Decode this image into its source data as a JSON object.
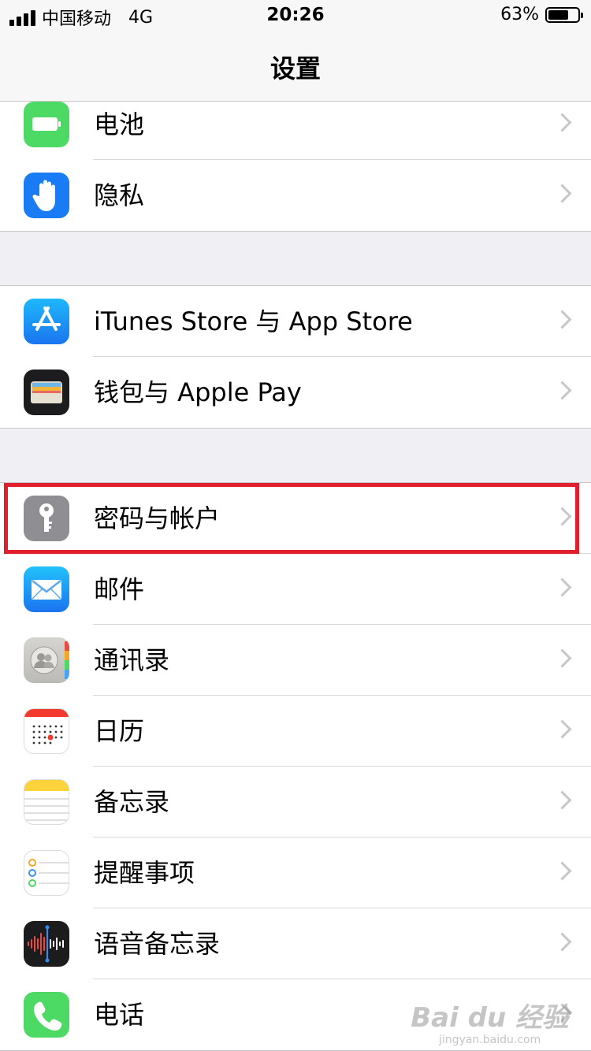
{
  "status": {
    "carrier": "中国移动",
    "network": "4G",
    "time": "20:26",
    "battery": "63%"
  },
  "nav": {
    "title": "设置"
  },
  "group1": [
    {
      "label": "电池",
      "icon": "battery-icon",
      "color": "#4cd964"
    },
    {
      "label": "隐私",
      "icon": "privacy-hand-icon",
      "color": "#1a7cf5"
    }
  ],
  "group2": [
    {
      "label": "iTunes Store 与 App Store",
      "icon": "app-store-icon",
      "color": "#1d9bf6"
    },
    {
      "label": "钱包与 Apple Pay",
      "icon": "wallet-icon",
      "color": "#1c1c1e"
    }
  ],
  "group3": [
    {
      "label": "密码与帐户",
      "icon": "key-icon",
      "color": "#8e8e93"
    },
    {
      "label": "邮件",
      "icon": "mail-icon",
      "color": "#1f8ff7"
    },
    {
      "label": "通讯录",
      "icon": "contacts-icon",
      "color": "#c9c7c4"
    },
    {
      "label": "日历",
      "icon": "calendar-icon",
      "color": "#ffffff"
    },
    {
      "label": "备忘录",
      "icon": "notes-icon",
      "color": "#ffffff"
    },
    {
      "label": "提醒事项",
      "icon": "reminders-icon",
      "color": "#ffffff"
    },
    {
      "label": "语音备忘录",
      "icon": "voice-memos-icon",
      "color": "#1c1c1e"
    },
    {
      "label": "电话",
      "icon": "phone-icon",
      "color": "#4cd964"
    }
  ],
  "watermark": {
    "brand": "Bai du 经验",
    "url": "jingyan.baidu.com"
  }
}
